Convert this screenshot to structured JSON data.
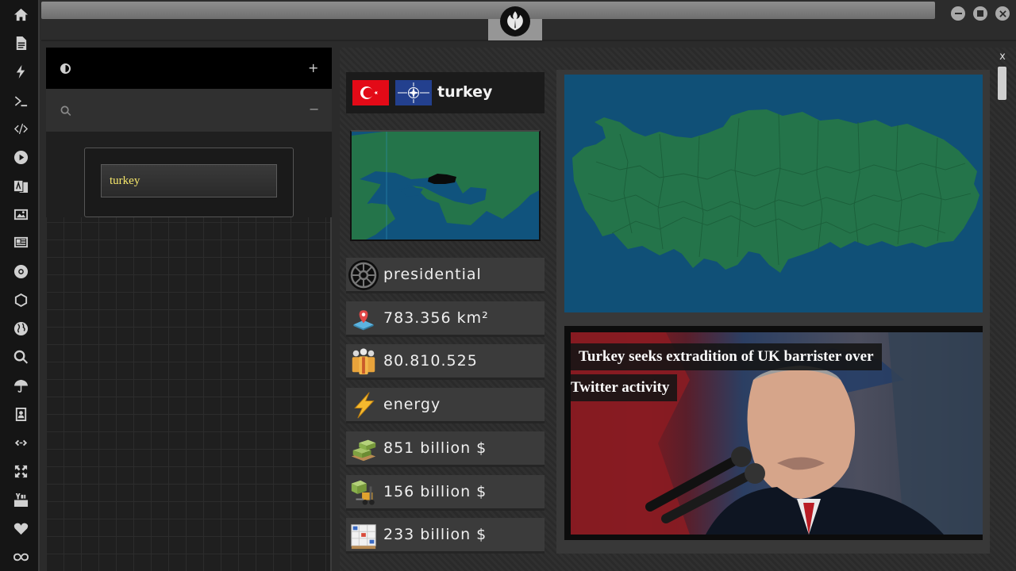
{
  "sidebar": {
    "icons": [
      "home-icon",
      "document-icon",
      "bolt-icon",
      "terminal-icon",
      "code-icon",
      "play-icon",
      "translate-icon",
      "image-icon",
      "newspaper-icon",
      "galactic-empire-icon",
      "hexagon-icon",
      "globe-icon",
      "search-icon",
      "umbrella-icon",
      "contacts-icon",
      "link-icon",
      "expand-icon",
      "youtube-icon",
      "heart-icon",
      "infinity-icon"
    ]
  },
  "search_panel": {
    "search_value": "turkey",
    "header_plus": "+",
    "subheader_minus": "−"
  },
  "country": {
    "name": "turkey",
    "close_label": "x",
    "stats": [
      {
        "icon": "galactic-empire-icon",
        "text": "presidential"
      },
      {
        "icon": "map-pin-icon",
        "text": "783.356 km²"
      },
      {
        "icon": "population-icon",
        "text": "80.810.525"
      },
      {
        "icon": "energy-bolt-icon",
        "text": "energy"
      },
      {
        "icon": "money-pallet-icon",
        "text": "851 billion $"
      },
      {
        "icon": "forklift-icon",
        "text": "156 billion $"
      },
      {
        "icon": "cargo-boxes-icon",
        "text": "233 billion $"
      }
    ]
  },
  "news": {
    "headline_line1": "Turkey seeks extradition of UK barrister over",
    "headline_line2": "Twitter activity"
  },
  "colors": {
    "land": "#24744a",
    "sea": "#10537d",
    "highlight": "#0a0a0a",
    "search_text": "#f5e66a"
  }
}
